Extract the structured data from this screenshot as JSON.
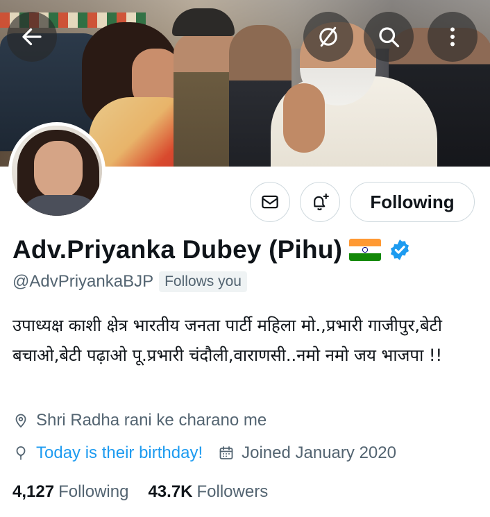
{
  "header": {
    "icons": {
      "back": "arrow-left-icon",
      "mute": "mute-slash-icon",
      "search": "search-icon",
      "more": "more-vertical-icon"
    }
  },
  "actions": {
    "message_icon": "envelope-icon",
    "notify_icon": "bell-plus-icon",
    "following_label": "Following"
  },
  "profile": {
    "name": "Adv.Priyanka Dubey (Pihu)",
    "flag_icon": "india-flag-icon",
    "verified_icon": "verified-badge-icon",
    "handle": "@AdvPriyankaBJP",
    "follows_you": "Follows you",
    "bio": "उपाध्यक्ष काशी क्षेत्र भारतीय जनता पार्टी महिला मो.,प्रभारी गाजीपुर,बेटी बचाओ,बेटी पढ़ाओ पू.प्रभारी चंदौली,वाराणसी..नमो नमो जय भाजपा !!",
    "location": "Shri Radha rani ke charano me",
    "birthday": "Today is their birthday!",
    "joined": "Joined January 2020"
  },
  "stats": {
    "following_count": "4,127",
    "following_label": "Following",
    "followers_count": "43.7K",
    "followers_label": "Followers"
  },
  "colors": {
    "accent": "#1d9bf0",
    "text_primary": "#0f1419",
    "text_secondary": "#536471",
    "border": "#cfd9de"
  }
}
